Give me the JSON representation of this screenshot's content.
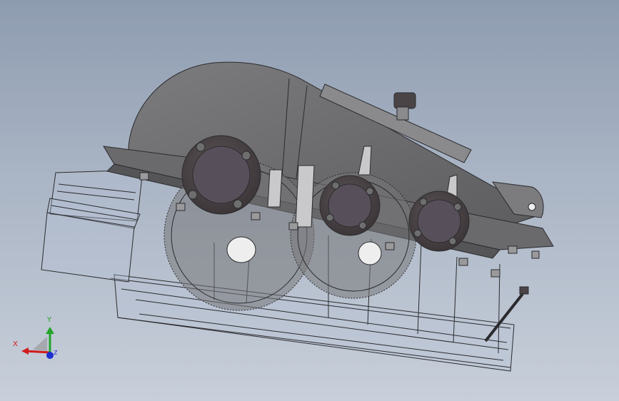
{
  "viewport": {
    "background_top": "#8e9cb0",
    "background_bottom": "#c8cfda",
    "model": {
      "housing_color": "#6f6f70",
      "housing_dark": "#4f4f52",
      "flange_color": "#5b5557",
      "edge_color": "#2b2b2e",
      "glass_color": "#b8c3d6"
    }
  },
  "triad": {
    "x_label": "X",
    "y_label": "Y",
    "z_label": "Z",
    "x_color": "#d01c1c",
    "y_color": "#22a32a",
    "z_color": "#1c2fd0"
  }
}
